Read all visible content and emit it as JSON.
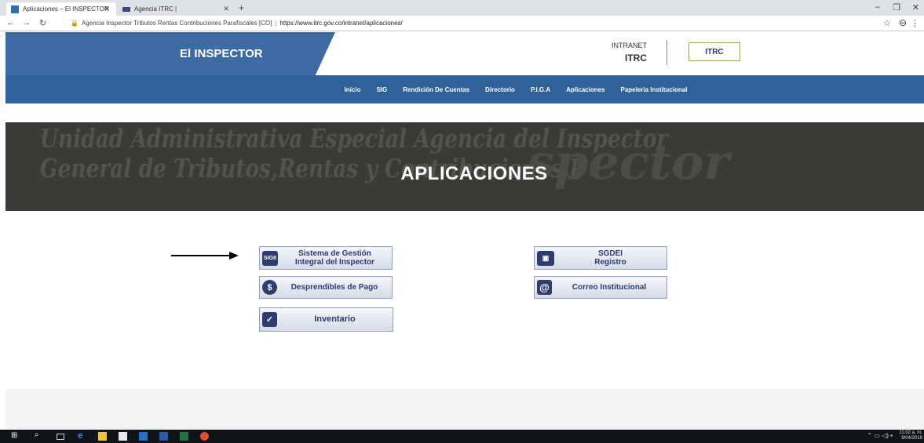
{
  "browser": {
    "tabs": [
      {
        "title": "Aplicaciones – El INSPECTOR",
        "active": true
      },
      {
        "title": "Agencia ITRC |",
        "active": false
      }
    ],
    "new_tab": "+",
    "address": {
      "site_label": "Agencia Inspector Tributos Rentas Contribuciones Parafiscales [CO]",
      "url": "https://www.itrc.gov.co/intranet/aplicaciones/"
    }
  },
  "header": {
    "brand": "El INSPECTOR",
    "intranet_line1": "INTRANET",
    "intranet_line2": "ITRC",
    "logo_text": "ITRC"
  },
  "nav": {
    "items": [
      "Inicio",
      "SIG",
      "Rendición De Cuentas",
      "Directorio",
      "P.I.G.A",
      "Aplicaciones",
      "Papeleria Institucional"
    ]
  },
  "hero": {
    "title": "APLICACIONES",
    "bg_line1": "Unidad Administrativa Especial Agencia del Inspector",
    "bg_line2": "General de Tributos,Rentas y Contribuciones P",
    "bg_big": "spector"
  },
  "apps": {
    "sigii": {
      "icon_text": "SIGII",
      "line1": "Sistema de Gestión",
      "line2": "Integral del Inspector"
    },
    "sgdei": {
      "line1": "SGDEI",
      "line2": "Registro"
    },
    "desprendibles": {
      "icon_text": "$",
      "label": "Desprendibles de Pago"
    },
    "correo": {
      "icon_text": "@",
      "label": "Correo Institucional"
    },
    "inventario": {
      "icon_text": "✓",
      "label": "Inventario"
    }
  },
  "taskbar": {
    "time": "11:02 a. m.",
    "date": "9/04/2019"
  },
  "colors": {
    "header_blue": "#3e6ba6",
    "nav_blue": "#2f6299",
    "button_text": "#2a3b74",
    "logo_border": "#8cb23c"
  }
}
